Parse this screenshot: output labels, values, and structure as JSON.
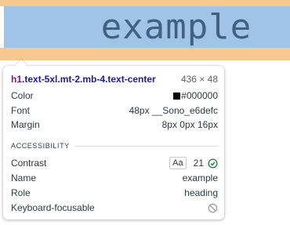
{
  "page": {
    "element_text": "example"
  },
  "tooltip": {
    "selector_tag": "h1",
    "selector_classes": ".text-5xl.mt-2.mb-4.text-center",
    "dimensions": "436 × 48",
    "rows": {
      "color_label": "Color",
      "color_value": "#000000",
      "font_label": "Font",
      "font_value": "48px __Sono_e6defc",
      "margin_label": "Margin",
      "margin_value": "8px 0px 16px"
    },
    "accessibility": {
      "section_title": "ACCESSIBILITY",
      "contrast_label": "Contrast",
      "contrast_badge": "Aa",
      "contrast_value": "21",
      "name_label": "Name",
      "name_value": "example",
      "role_label": "Role",
      "role_value": "heading",
      "keyboard_label": "Keyboard-focusable"
    }
  },
  "colors": {
    "margin_highlight": "#f7c98f",
    "content_highlight": "#a0c4e8",
    "ok_green": "#188038",
    "swatch": "#000000"
  },
  "icons": {
    "contrast_status": "check-circle-icon",
    "keyboard_focusable": "not-allowed-icon"
  }
}
